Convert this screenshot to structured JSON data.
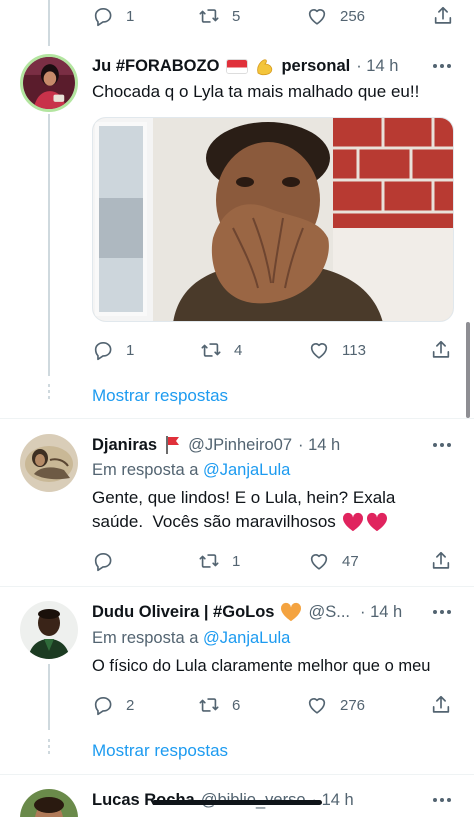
{
  "top_actions": {
    "reply_count": "1",
    "retweet_count": "5",
    "like_count": "256"
  },
  "tweet1": {
    "name": "Ju #FORABOZO",
    "name_suffix": "personal",
    "time": "· 14 h",
    "text": "Chocada q o Lyla ta mais malhado que eu!!",
    "actions": {
      "reply_count": "1",
      "retweet_count": "4",
      "like_count": "113"
    }
  },
  "show_replies_1": "Mostrar respostas",
  "tweet2": {
    "name": "Djaniras",
    "handle": "@JPinheiro07",
    "time": "· 14 h",
    "reply_prefix": "Em resposta a ",
    "reply_handle": "@JanjaLula",
    "text_line1": "Gente, que lindos! E o Lula, hein? Exala",
    "text_line2": "saúde.  Vocês são maravilhosos",
    "actions": {
      "reply_count": "",
      "retweet_count": "1",
      "like_count": "47"
    }
  },
  "tweet3": {
    "name": "Dudu Oliveira | #GoLos",
    "handle": "@S...",
    "time": "· 14 h",
    "reply_prefix": "Em resposta a ",
    "reply_handle": "@JanjaLula",
    "text": "O físico do Lula claramente melhor que o meu",
    "actions": {
      "reply_count": "2",
      "retweet_count": "6",
      "like_count": "276"
    }
  },
  "show_replies_2": "Mostrar respostas",
  "tweet4": {
    "name": "Lucas Rocha",
    "handle": "@biblio_verso",
    "time": "· 14 h"
  },
  "colors": {
    "accent": "#1d9bf0",
    "secondary_text": "#536471",
    "primary_text": "#0f1419",
    "heart_red": "#e0245e",
    "flag_red": "#e0303a",
    "orange_heart": "#f4a340"
  }
}
